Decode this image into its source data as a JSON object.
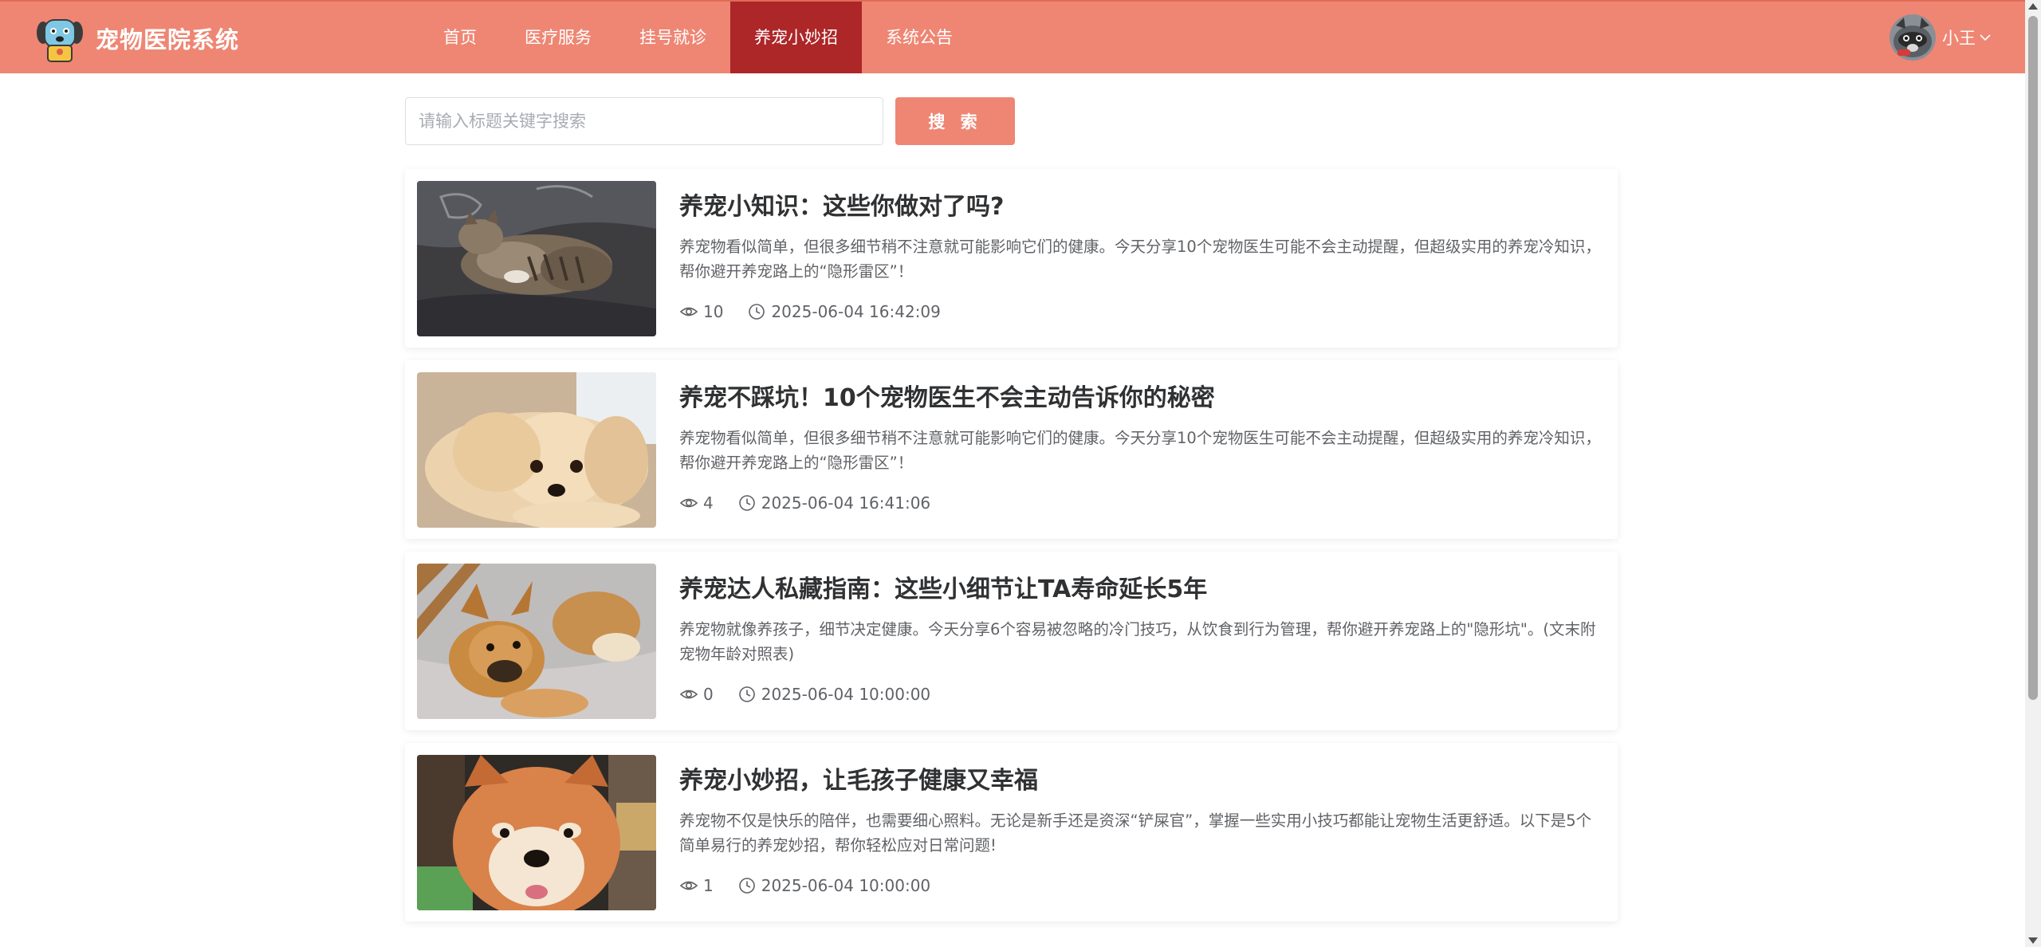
{
  "header": {
    "title": "宠物医院系统",
    "nav": [
      "首页",
      "医疗服务",
      "挂号就诊",
      "养宠小妙招",
      "系统公告"
    ],
    "active_nav": "养宠小妙招",
    "user_name": "小王",
    "colors": {
      "header_bg": "#ee8673",
      "active_bg": "#ad2628"
    }
  },
  "search": {
    "placeholder": "请输入标题关键字搜索",
    "value": "",
    "button_label": "搜 索"
  },
  "articles": [
    {
      "title": "养宠小知识：这些你做对了吗?",
      "desc": "养宠物看似简单，但很多细节稍不注意就可能影响它们的健康。今天分享10个宠物医生可能不会主动提醒，但超级实用的养宠冷知识，帮你避开养宠路上的“隐形雷区”！",
      "views": "10",
      "time": "2025-06-04 16:42:09",
      "image": "tabby-cat-lying"
    },
    {
      "title": "养宠不踩坑！10个宠物医生不会主动告诉你的秘密",
      "desc": "养宠物看似简单，但很多细节稍不注意就可能影响它们的健康。今天分享10个宠物医生可能不会主动提醒，但超级实用的养宠冷知识，帮你避开养宠路上的“隐形雷区”！",
      "views": "4",
      "time": "2025-06-04 16:41:06",
      "image": "fluffy-cream-dog"
    },
    {
      "title": "养宠达人私藏指南：这些小细节让TA寿命延长5年",
      "desc": "养宠物就像养孩子，细节决定健康。今天分享6个容易被忽略的冷门技巧，从饮食到行为管理，帮你避开养宠路上的\"隐形坑\"。(文末附宠物年龄对照表)",
      "views": "0",
      "time": "2025-06-04 10:00:00",
      "image": "tan-puppies"
    },
    {
      "title": "养宠小妙招，让毛孩子健康又幸福",
      "desc": "养宠物不仅是快乐的陪伴，也需要细心照料。无论是新手还是资深“铲屎官”，掌握一些实用小技巧都能让宠物生活更舒适。以下是5个简单易行的养宠妙招，帮你轻松应对日常问题!",
      "views": "1",
      "time": "2025-06-04 10:00:00",
      "image": "shiba-inu-face"
    }
  ]
}
